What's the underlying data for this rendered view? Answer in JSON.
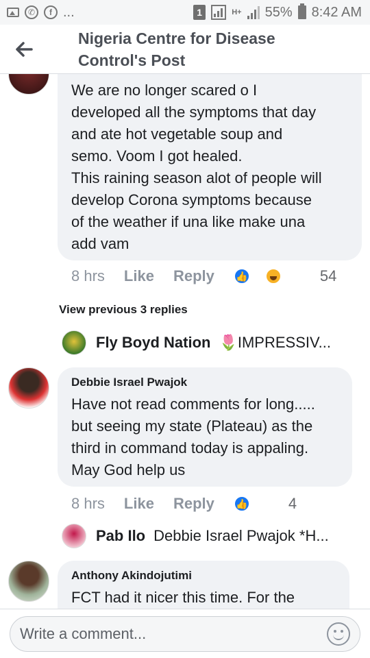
{
  "status_bar": {
    "left_more": "...",
    "sim_number": "1",
    "network_type": "H+",
    "battery_percent": "55%",
    "time": "8:42 AM",
    "icons": [
      "image-icon",
      "whatsapp-icon",
      "facebook-icon",
      "sim-icon",
      "signal-box-icon",
      "signal-icon",
      "battery-icon"
    ]
  },
  "header": {
    "title_line1": "Nigeria Centre for Disease",
    "title_line2": "Control's Post",
    "back_icon": "back-arrow-icon"
  },
  "comments": [
    {
      "author": "",
      "text": "We are no longer scared o I\ndeveloped all the symptoms that day\nand ate hot vegetable soup and\nsemo. Voom I got healed.\nThis raining season alot of people will\ndevelop Corona symptoms because\nof the weather if una like make una\nadd vam",
      "time": "8 hrs",
      "like_label": "Like",
      "reply_label": "Reply",
      "reactions": [
        "like",
        "haha"
      ],
      "reaction_count": "54"
    },
    {
      "author": "Debbie Israel Pwajok",
      "text": "Have not read comments for long.....\nbut seeing my state (Plateau) as the\nthird in command today is appaling.\nMay God help us",
      "time": "8 hrs",
      "like_label": "Like",
      "reply_label": "Reply",
      "reactions": [
        "like"
      ],
      "reaction_count": "4"
    },
    {
      "author": "Anthony Akindojutimi",
      "text": "FCT had it nicer this time. For the"
    }
  ],
  "view_previous_replies": "View previous 3 replies",
  "replies": [
    {
      "name": "Fly Boyd Nation",
      "text": "🌷IMPRESSIV..."
    },
    {
      "name": "Pab Ilo",
      "text": "Debbie Israel Pwajok *H..."
    }
  ],
  "composer": {
    "placeholder": "Write a comment...",
    "emoji_icon": "emoji-icon"
  },
  "colors": {
    "bubble": "#f0f2f5",
    "meta_text": "#8d949e",
    "like_blue": "#1877f2",
    "header_text": "#4b4f56"
  }
}
